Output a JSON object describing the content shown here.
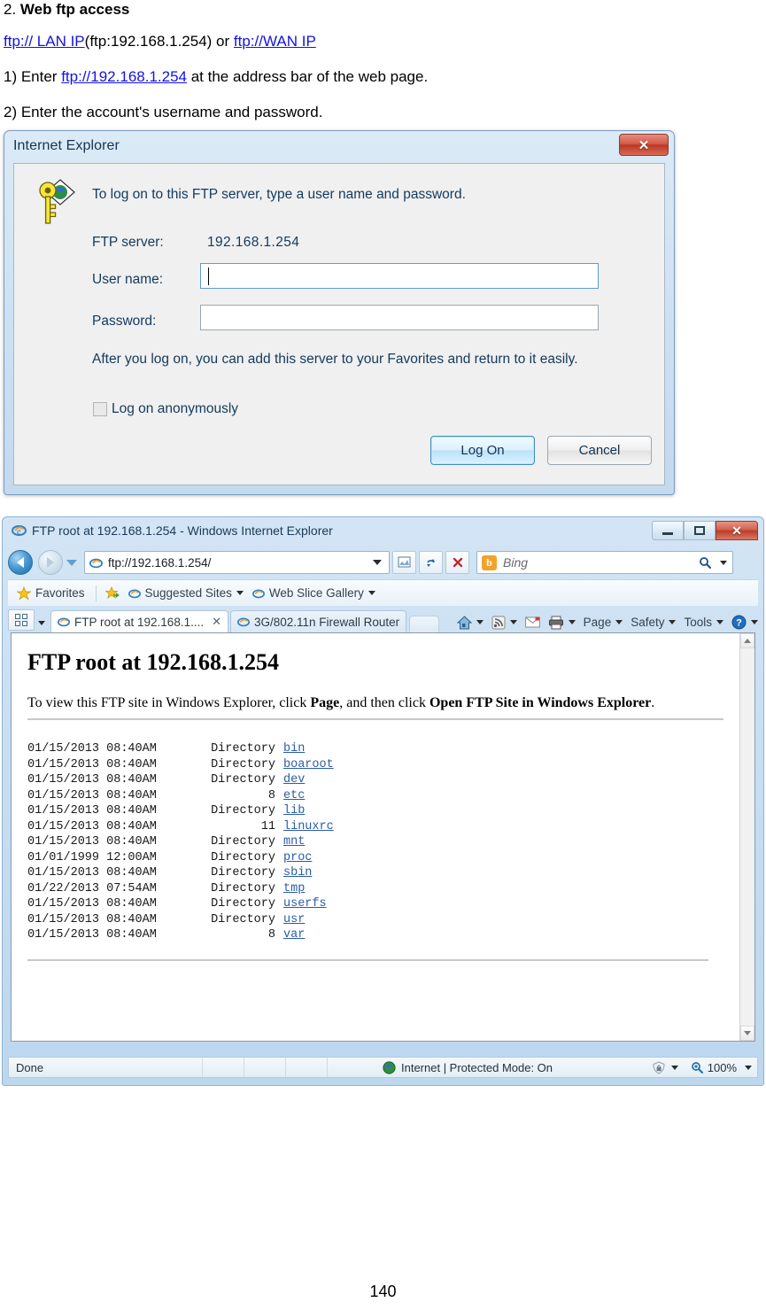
{
  "document": {
    "section_number": "2.",
    "section_title": "Web ftp access",
    "url_line": {
      "link1": "ftp:// LAN IP",
      "mid": "(ftp:192.168.1.254) or ",
      "link2": "ftp://WAN IP"
    },
    "step1": {
      "prefix": "1) Enter ",
      "link": "ftp://192.168.1.254",
      "suffix": " at the address bar of the web page."
    },
    "step2": "2) Enter the account's username and password.",
    "page_number": "140"
  },
  "logon_dialog": {
    "title": "Internet Explorer",
    "close_label": "✕",
    "prompt": "To log on to this FTP server, type a user name and password.",
    "server_label": "FTP server:",
    "server_value": "192.168.1.254",
    "username_label": "User name:",
    "username_value": "",
    "password_label": "Password:",
    "password_value": "",
    "note": "After you log on, you can add this server to your Favorites and return to it easily.",
    "anonymous_label": "Log on anonymously",
    "logon_button": "Log On",
    "cancel_button": "Cancel"
  },
  "browser": {
    "window_title": "FTP root at 192.168.1.254 - Windows Internet Explorer",
    "window_controls": {
      "minimize": "–",
      "maximize": "□",
      "close": "✕"
    },
    "address_value": "ftp://192.168.1.254/",
    "toolbar_buttons": {
      "compat": "compatibility-view",
      "refresh": "↻",
      "stop": "✕"
    },
    "search": {
      "engine": "Bing",
      "placeholder": "Bing"
    },
    "favorites_bar": {
      "favorites": "Favorites",
      "items": [
        {
          "label": "Suggested Sites",
          "has_menu": true
        },
        {
          "label": "Web Slice Gallery",
          "has_menu": true
        }
      ]
    },
    "tabs": [
      {
        "label": "FTP root at 192.168.1....",
        "active": true,
        "close": "✕"
      },
      {
        "label": "3G/802.11n Firewall Router",
        "active": false
      }
    ],
    "command_bar": [
      {
        "label": "",
        "icon": "home-icon",
        "has_menu": true
      },
      {
        "label": "",
        "icon": "feeds-icon",
        "has_menu": true
      },
      {
        "label": "",
        "icon": "mail-icon",
        "has_menu": false
      },
      {
        "label": "",
        "icon": "print-icon",
        "has_menu": true
      },
      {
        "label": "Page",
        "icon": "",
        "has_menu": true
      },
      {
        "label": "Safety",
        "icon": "",
        "has_menu": true
      },
      {
        "label": "Tools",
        "icon": "",
        "has_menu": true
      },
      {
        "label": "",
        "icon": "help-icon",
        "has_menu": true
      }
    ],
    "status_bar": {
      "status": "Done",
      "zone": "Internet | Protected Mode: On",
      "zoom": "100%"
    }
  },
  "ftp_page": {
    "heading": "FTP root at 192.168.1.254",
    "instruction_pre": "To view this FTP site in Windows Explorer, click ",
    "instruction_b1": "Page",
    "instruction_mid": ", and then click ",
    "instruction_b2": "Open FTP Site in Windows Explorer",
    "instruction_post": ".",
    "listing": [
      {
        "date": "01/15/2013",
        "time": "08:40AM",
        "size": "Directory",
        "name": "bin"
      },
      {
        "date": "01/15/2013",
        "time": "08:40AM",
        "size": "Directory",
        "name": "boaroot"
      },
      {
        "date": "01/15/2013",
        "time": "08:40AM",
        "size": "Directory",
        "name": "dev"
      },
      {
        "date": "01/15/2013",
        "time": "08:40AM",
        "size": "8",
        "name": "etc"
      },
      {
        "date": "01/15/2013",
        "time": "08:40AM",
        "size": "Directory",
        "name": "lib"
      },
      {
        "date": "01/15/2013",
        "time": "08:40AM",
        "size": "11",
        "name": "linuxrc"
      },
      {
        "date": "01/15/2013",
        "time": "08:40AM",
        "size": "Directory",
        "name": "mnt"
      },
      {
        "date": "01/01/1999",
        "time": "12:00AM",
        "size": "Directory",
        "name": "proc"
      },
      {
        "date": "01/15/2013",
        "time": "08:40AM",
        "size": "Directory",
        "name": "sbin"
      },
      {
        "date": "01/22/2013",
        "time": "07:54AM",
        "size": "Directory",
        "name": "tmp"
      },
      {
        "date": "01/15/2013",
        "time": "08:40AM",
        "size": "Directory",
        "name": "userfs"
      },
      {
        "date": "01/15/2013",
        "time": "08:40AM",
        "size": "Directory",
        "name": "usr"
      },
      {
        "date": "01/15/2013",
        "time": "08:40AM",
        "size": "8",
        "name": "var"
      }
    ]
  },
  "colors": {
    "link": "#1313e0",
    "ftp_link": "#2b5ca8",
    "chrome_blue": "#c8dff2",
    "close_red": "#bb3c29",
    "bing_orange": "#f3a229"
  }
}
